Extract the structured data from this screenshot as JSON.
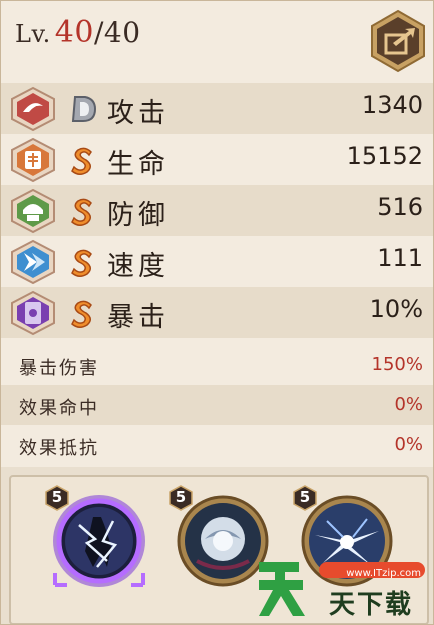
{
  "level": {
    "prefix": "Lv.",
    "current": "40",
    "max": "/40"
  },
  "stats": [
    {
      "grade": "D",
      "name": "攻击",
      "value": "1340",
      "icon": "attack-icon"
    },
    {
      "grade": "S",
      "name": "生命",
      "value": "15152",
      "icon": "health-icon"
    },
    {
      "grade": "S",
      "name": "防御",
      "value": "516",
      "icon": "defense-icon"
    },
    {
      "grade": "S",
      "name": "速度",
      "value": "111",
      "icon": "speed-icon"
    },
    {
      "grade": "S",
      "name": "暴击",
      "value": "10%",
      "icon": "crit-icon"
    }
  ],
  "sub_stats": [
    {
      "name": "暴击伤害",
      "value": "150%"
    },
    {
      "name": "效果命中",
      "value": "0%"
    },
    {
      "name": "效果抵抗",
      "value": "0%"
    }
  ],
  "skills": [
    {
      "level": "5",
      "icon": "lightning-skill-icon"
    },
    {
      "level": "5",
      "icon": "orb-skill-icon"
    },
    {
      "level": "5",
      "icon": "burst-skill-icon"
    }
  ],
  "watermark": {
    "site": "www.ITzip.com",
    "text": "天下载"
  },
  "colors": {
    "accent_red": "#b4342a",
    "panel": "#f3ebdf",
    "grade_s": "#e8852a",
    "grade_d": "#8a8f99"
  }
}
